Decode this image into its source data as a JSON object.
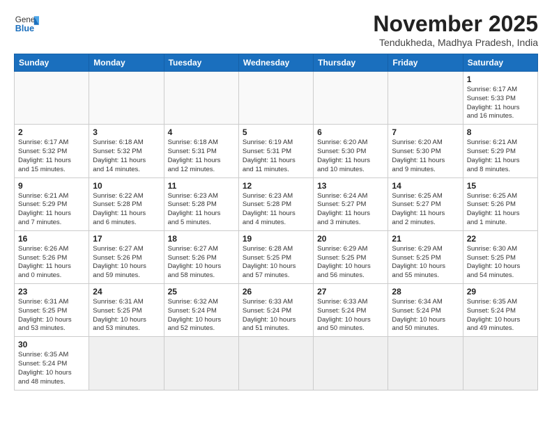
{
  "header": {
    "logo_general": "General",
    "logo_blue": "Blue",
    "month_title": "November 2025",
    "location": "Tendukheda, Madhya Pradesh, India"
  },
  "weekdays": [
    "Sunday",
    "Monday",
    "Tuesday",
    "Wednesday",
    "Thursday",
    "Friday",
    "Saturday"
  ],
  "weeks": [
    [
      {
        "day": "",
        "info": ""
      },
      {
        "day": "",
        "info": ""
      },
      {
        "day": "",
        "info": ""
      },
      {
        "day": "",
        "info": ""
      },
      {
        "day": "",
        "info": ""
      },
      {
        "day": "",
        "info": ""
      },
      {
        "day": "1",
        "info": "Sunrise: 6:17 AM\nSunset: 5:33 PM\nDaylight: 11 hours\nand 16 minutes."
      }
    ],
    [
      {
        "day": "2",
        "info": "Sunrise: 6:17 AM\nSunset: 5:32 PM\nDaylight: 11 hours\nand 15 minutes."
      },
      {
        "day": "3",
        "info": "Sunrise: 6:18 AM\nSunset: 5:32 PM\nDaylight: 11 hours\nand 14 minutes."
      },
      {
        "day": "4",
        "info": "Sunrise: 6:18 AM\nSunset: 5:31 PM\nDaylight: 11 hours\nand 12 minutes."
      },
      {
        "day": "5",
        "info": "Sunrise: 6:19 AM\nSunset: 5:31 PM\nDaylight: 11 hours\nand 11 minutes."
      },
      {
        "day": "6",
        "info": "Sunrise: 6:20 AM\nSunset: 5:30 PM\nDaylight: 11 hours\nand 10 minutes."
      },
      {
        "day": "7",
        "info": "Sunrise: 6:20 AM\nSunset: 5:30 PM\nDaylight: 11 hours\nand 9 minutes."
      },
      {
        "day": "8",
        "info": "Sunrise: 6:21 AM\nSunset: 5:29 PM\nDaylight: 11 hours\nand 8 minutes."
      }
    ],
    [
      {
        "day": "9",
        "info": "Sunrise: 6:21 AM\nSunset: 5:29 PM\nDaylight: 11 hours\nand 7 minutes."
      },
      {
        "day": "10",
        "info": "Sunrise: 6:22 AM\nSunset: 5:28 PM\nDaylight: 11 hours\nand 6 minutes."
      },
      {
        "day": "11",
        "info": "Sunrise: 6:23 AM\nSunset: 5:28 PM\nDaylight: 11 hours\nand 5 minutes."
      },
      {
        "day": "12",
        "info": "Sunrise: 6:23 AM\nSunset: 5:28 PM\nDaylight: 11 hours\nand 4 minutes."
      },
      {
        "day": "13",
        "info": "Sunrise: 6:24 AM\nSunset: 5:27 PM\nDaylight: 11 hours\nand 3 minutes."
      },
      {
        "day": "14",
        "info": "Sunrise: 6:25 AM\nSunset: 5:27 PM\nDaylight: 11 hours\nand 2 minutes."
      },
      {
        "day": "15",
        "info": "Sunrise: 6:25 AM\nSunset: 5:26 PM\nDaylight: 11 hours\nand 1 minute."
      }
    ],
    [
      {
        "day": "16",
        "info": "Sunrise: 6:26 AM\nSunset: 5:26 PM\nDaylight: 11 hours\nand 0 minutes."
      },
      {
        "day": "17",
        "info": "Sunrise: 6:27 AM\nSunset: 5:26 PM\nDaylight: 10 hours\nand 59 minutes."
      },
      {
        "day": "18",
        "info": "Sunrise: 6:27 AM\nSunset: 5:26 PM\nDaylight: 10 hours\nand 58 minutes."
      },
      {
        "day": "19",
        "info": "Sunrise: 6:28 AM\nSunset: 5:25 PM\nDaylight: 10 hours\nand 57 minutes."
      },
      {
        "day": "20",
        "info": "Sunrise: 6:29 AM\nSunset: 5:25 PM\nDaylight: 10 hours\nand 56 minutes."
      },
      {
        "day": "21",
        "info": "Sunrise: 6:29 AM\nSunset: 5:25 PM\nDaylight: 10 hours\nand 55 minutes."
      },
      {
        "day": "22",
        "info": "Sunrise: 6:30 AM\nSunset: 5:25 PM\nDaylight: 10 hours\nand 54 minutes."
      }
    ],
    [
      {
        "day": "23",
        "info": "Sunrise: 6:31 AM\nSunset: 5:25 PM\nDaylight: 10 hours\nand 53 minutes."
      },
      {
        "day": "24",
        "info": "Sunrise: 6:31 AM\nSunset: 5:25 PM\nDaylight: 10 hours\nand 53 minutes."
      },
      {
        "day": "25",
        "info": "Sunrise: 6:32 AM\nSunset: 5:24 PM\nDaylight: 10 hours\nand 52 minutes."
      },
      {
        "day": "26",
        "info": "Sunrise: 6:33 AM\nSunset: 5:24 PM\nDaylight: 10 hours\nand 51 minutes."
      },
      {
        "day": "27",
        "info": "Sunrise: 6:33 AM\nSunset: 5:24 PM\nDaylight: 10 hours\nand 50 minutes."
      },
      {
        "day": "28",
        "info": "Sunrise: 6:34 AM\nSunset: 5:24 PM\nDaylight: 10 hours\nand 50 minutes."
      },
      {
        "day": "29",
        "info": "Sunrise: 6:35 AM\nSunset: 5:24 PM\nDaylight: 10 hours\nand 49 minutes."
      }
    ],
    [
      {
        "day": "30",
        "info": "Sunrise: 6:35 AM\nSunset: 5:24 PM\nDaylight: 10 hours\nand 48 minutes.",
        "last": true
      },
      {
        "day": "",
        "info": "",
        "last": true
      },
      {
        "day": "",
        "info": "",
        "last": true
      },
      {
        "day": "",
        "info": "",
        "last": true
      },
      {
        "day": "",
        "info": "",
        "last": true
      },
      {
        "day": "",
        "info": "",
        "last": true
      },
      {
        "day": "",
        "info": "",
        "last": true
      }
    ]
  ]
}
